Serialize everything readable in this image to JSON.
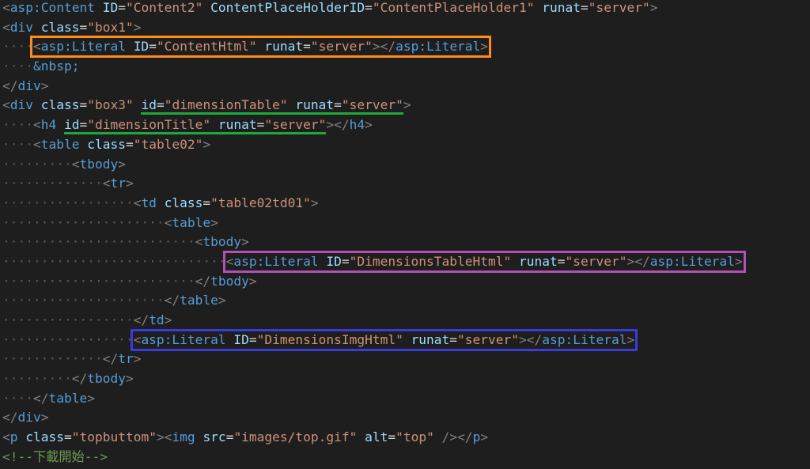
{
  "editor": {
    "lines": [
      {
        "indent": "",
        "tokens": [
          {
            "t": "<",
            "c": "punct"
          },
          {
            "t": "asp:Content",
            "c": "tag"
          },
          {
            "t": " ",
            "c": "plain"
          },
          {
            "t": "ID",
            "c": "attr"
          },
          {
            "t": "=",
            "c": "plain"
          },
          {
            "t": "\"Content2\"",
            "c": "val"
          },
          {
            "t": " ",
            "c": "plain"
          },
          {
            "t": "ContentPlaceHolderID",
            "c": "attr"
          },
          {
            "t": "=",
            "c": "plain"
          },
          {
            "t": "\"ContentPlaceHolder1\"",
            "c": "val"
          },
          {
            "t": " ",
            "c": "plain"
          },
          {
            "t": "runat",
            "c": "attr"
          },
          {
            "t": "=",
            "c": "plain"
          },
          {
            "t": "\"server\"",
            "c": "val"
          },
          {
            "t": ">",
            "c": "punct"
          }
        ]
      },
      {
        "indent": "",
        "tokens": [
          {
            "t": "<",
            "c": "punct"
          },
          {
            "t": "div",
            "c": "tag"
          },
          {
            "t": " ",
            "c": "plain"
          },
          {
            "t": "class",
            "c": "attr"
          },
          {
            "t": "=",
            "c": "plain"
          },
          {
            "t": "\"box1\"",
            "c": "val"
          },
          {
            "t": ">",
            "c": "punct"
          }
        ]
      },
      {
        "indent": "····",
        "highlight": "hl-orange",
        "tokens": [
          {
            "t": "<",
            "c": "punct"
          },
          {
            "t": "asp:Literal",
            "c": "tag"
          },
          {
            "t": " ",
            "c": "plain"
          },
          {
            "t": "ID",
            "c": "attr"
          },
          {
            "t": "=",
            "c": "plain"
          },
          {
            "t": "\"ContentHtml\"",
            "c": "val"
          },
          {
            "t": " ",
            "c": "plain"
          },
          {
            "t": "runat",
            "c": "attr"
          },
          {
            "t": "=",
            "c": "plain"
          },
          {
            "t": "\"server\"",
            "c": "val"
          },
          {
            "t": "></",
            "c": "punct"
          },
          {
            "t": "asp:Literal",
            "c": "tag"
          },
          {
            "t": ">",
            "c": "punct"
          }
        ]
      },
      {
        "indent": "····",
        "tokens": [
          {
            "t": "&nbsp;",
            "c": "entity"
          }
        ]
      },
      {
        "indent": "",
        "tokens": [
          {
            "t": "</",
            "c": "punct"
          },
          {
            "t": "div",
            "c": "tag"
          },
          {
            "t": ">",
            "c": "punct"
          }
        ]
      },
      {
        "indent": "",
        "tokens": [
          {
            "t": "<",
            "c": "punct"
          },
          {
            "t": "div",
            "c": "tag"
          },
          {
            "t": " ",
            "c": "plain"
          },
          {
            "t": "class",
            "c": "attr"
          },
          {
            "t": "=",
            "c": "plain"
          },
          {
            "t": "\"box3\"",
            "c": "val"
          },
          {
            "t": " ",
            "c": "plain"
          },
          {
            "t": "id",
            "c": "attr",
            "u": true
          },
          {
            "t": "=",
            "c": "plain",
            "u": true
          },
          {
            "t": "\"dimensionTable\"",
            "c": "val",
            "u": true
          },
          {
            "t": " ",
            "c": "plain",
            "u": true
          },
          {
            "t": "runat",
            "c": "attr",
            "u": true
          },
          {
            "t": "=",
            "c": "plain",
            "u": true
          },
          {
            "t": "\"server\"",
            "c": "val",
            "u": true
          },
          {
            "t": ">",
            "c": "punct"
          }
        ]
      },
      {
        "indent": "····",
        "tokens": [
          {
            "t": "<",
            "c": "punct"
          },
          {
            "t": "h4",
            "c": "tag"
          },
          {
            "t": " ",
            "c": "plain"
          },
          {
            "t": "id",
            "c": "attr",
            "u": true
          },
          {
            "t": "=",
            "c": "plain",
            "u": true
          },
          {
            "t": "\"dimensionTitle\"",
            "c": "val",
            "u": true
          },
          {
            "t": " ",
            "c": "plain",
            "u": true
          },
          {
            "t": "runat",
            "c": "attr",
            "u": true
          },
          {
            "t": "=",
            "c": "plain",
            "u": true
          },
          {
            "t": "\"server\"",
            "c": "val",
            "u": true
          },
          {
            "t": "></",
            "c": "punct"
          },
          {
            "t": "h4",
            "c": "tag"
          },
          {
            "t": ">",
            "c": "punct"
          }
        ]
      },
      {
        "indent": "····",
        "tokens": [
          {
            "t": "<",
            "c": "punct"
          },
          {
            "t": "table",
            "c": "tag"
          },
          {
            "t": " ",
            "c": "plain"
          },
          {
            "t": "class",
            "c": "attr"
          },
          {
            "t": "=",
            "c": "plain"
          },
          {
            "t": "\"table02\"",
            "c": "val"
          },
          {
            "t": ">",
            "c": "punct"
          }
        ]
      },
      {
        "indent": "·········",
        "tokens": [
          {
            "t": "<",
            "c": "punct"
          },
          {
            "t": "tbody",
            "c": "tag"
          },
          {
            "t": ">",
            "c": "punct"
          }
        ]
      },
      {
        "indent": "·············",
        "tokens": [
          {
            "t": "<",
            "c": "punct"
          },
          {
            "t": "tr",
            "c": "tag"
          },
          {
            "t": ">",
            "c": "punct"
          }
        ]
      },
      {
        "indent": "·················",
        "tokens": [
          {
            "t": "<",
            "c": "punct"
          },
          {
            "t": "td",
            "c": "tag"
          },
          {
            "t": " ",
            "c": "plain"
          },
          {
            "t": "class",
            "c": "attr"
          },
          {
            "t": "=",
            "c": "plain"
          },
          {
            "t": "\"table02td01\"",
            "c": "val"
          },
          {
            "t": ">",
            "c": "punct"
          }
        ]
      },
      {
        "indent": "·····················",
        "tokens": [
          {
            "t": "<",
            "c": "punct"
          },
          {
            "t": "table",
            "c": "tag"
          },
          {
            "t": ">",
            "c": "punct"
          }
        ]
      },
      {
        "indent": "·························",
        "tokens": [
          {
            "t": "<",
            "c": "punct"
          },
          {
            "t": "tbody",
            "c": "tag"
          },
          {
            "t": ">",
            "c": "punct"
          }
        ]
      },
      {
        "indent": "·····························",
        "highlight": "hl-purple",
        "tokens": [
          {
            "t": "<",
            "c": "punct"
          },
          {
            "t": "asp:Literal",
            "c": "tag"
          },
          {
            "t": " ",
            "c": "plain"
          },
          {
            "t": "ID",
            "c": "attr"
          },
          {
            "t": "=",
            "c": "plain"
          },
          {
            "t": "\"DimensionsTableHtml\"",
            "c": "val"
          },
          {
            "t": " ",
            "c": "plain"
          },
          {
            "t": "runat",
            "c": "attr"
          },
          {
            "t": "=",
            "c": "plain"
          },
          {
            "t": "\"server\"",
            "c": "val"
          },
          {
            "t": "></",
            "c": "punct"
          },
          {
            "t": "asp:Literal",
            "c": "tag"
          },
          {
            "t": ">",
            "c": "punct"
          }
        ]
      },
      {
        "indent": "·························",
        "tokens": [
          {
            "t": "</",
            "c": "punct"
          },
          {
            "t": "tbody",
            "c": "tag"
          },
          {
            "t": ">",
            "c": "punct"
          }
        ]
      },
      {
        "indent": "·····················",
        "tokens": [
          {
            "t": "</",
            "c": "punct"
          },
          {
            "t": "table",
            "c": "tag"
          },
          {
            "t": ">",
            "c": "punct"
          }
        ]
      },
      {
        "indent": "·················",
        "tokens": [
          {
            "t": "</",
            "c": "punct"
          },
          {
            "t": "td",
            "c": "tag"
          },
          {
            "t": ">",
            "c": "punct"
          }
        ]
      },
      {
        "indent": "·················",
        "highlight": "hl-blue",
        "tokens": [
          {
            "t": "<",
            "c": "punct"
          },
          {
            "t": "asp:Literal",
            "c": "tag"
          },
          {
            "t": " ",
            "c": "plain"
          },
          {
            "t": "ID",
            "c": "attr"
          },
          {
            "t": "=",
            "c": "plain"
          },
          {
            "t": "\"DimensionsImgHtml\"",
            "c": "val"
          },
          {
            "t": " ",
            "c": "plain"
          },
          {
            "t": "runat",
            "c": "attr"
          },
          {
            "t": "=",
            "c": "plain"
          },
          {
            "t": "\"server\"",
            "c": "val"
          },
          {
            "t": "></",
            "c": "punct"
          },
          {
            "t": "asp:Literal",
            "c": "tag"
          },
          {
            "t": ">",
            "c": "punct"
          }
        ]
      },
      {
        "indent": "·············",
        "tokens": [
          {
            "t": "</",
            "c": "punct"
          },
          {
            "t": "tr",
            "c": "tag"
          },
          {
            "t": ">",
            "c": "punct"
          }
        ]
      },
      {
        "indent": "·········",
        "tokens": [
          {
            "t": "</",
            "c": "punct"
          },
          {
            "t": "tbody",
            "c": "tag"
          },
          {
            "t": ">",
            "c": "punct"
          }
        ]
      },
      {
        "indent": "····",
        "tokens": [
          {
            "t": "</",
            "c": "punct"
          },
          {
            "t": "table",
            "c": "tag"
          },
          {
            "t": ">",
            "c": "punct"
          }
        ]
      },
      {
        "indent": "",
        "tokens": [
          {
            "t": "</",
            "c": "punct"
          },
          {
            "t": "div",
            "c": "tag"
          },
          {
            "t": ">",
            "c": "punct"
          }
        ]
      },
      {
        "indent": "",
        "tokens": [
          {
            "t": "<",
            "c": "punct"
          },
          {
            "t": "p",
            "c": "tag"
          },
          {
            "t": " ",
            "c": "plain"
          },
          {
            "t": "class",
            "c": "attr"
          },
          {
            "t": "=",
            "c": "plain"
          },
          {
            "t": "\"topbuttom\"",
            "c": "val"
          },
          {
            "t": "><",
            "c": "punct"
          },
          {
            "t": "img",
            "c": "tag"
          },
          {
            "t": " ",
            "c": "plain"
          },
          {
            "t": "src",
            "c": "attr"
          },
          {
            "t": "=",
            "c": "plain"
          },
          {
            "t": "\"images/top.gif\"",
            "c": "val"
          },
          {
            "t": " ",
            "c": "plain"
          },
          {
            "t": "alt",
            "c": "attr"
          },
          {
            "t": "=",
            "c": "plain"
          },
          {
            "t": "\"top\"",
            "c": "val"
          },
          {
            "t": " ",
            "c": "plain"
          },
          {
            "t": "/></",
            "c": "punct"
          },
          {
            "t": "p",
            "c": "tag"
          },
          {
            "t": ">",
            "c": "punct"
          }
        ]
      },
      {
        "indent": "",
        "tokens": [
          {
            "t": "<!--下載開始-->",
            "c": "comment"
          }
        ]
      }
    ]
  },
  "colors": {
    "background": "#1e1e1e",
    "tag": "#569cd6",
    "attribute": "#9cdcfe",
    "string": "#ce9178",
    "comment": "#6a9955",
    "highlight_orange": "#ff8c1a",
    "highlight_purple": "#b44fb4",
    "highlight_blue": "#3b3bd9",
    "underline_green": "#1fa83a"
  }
}
